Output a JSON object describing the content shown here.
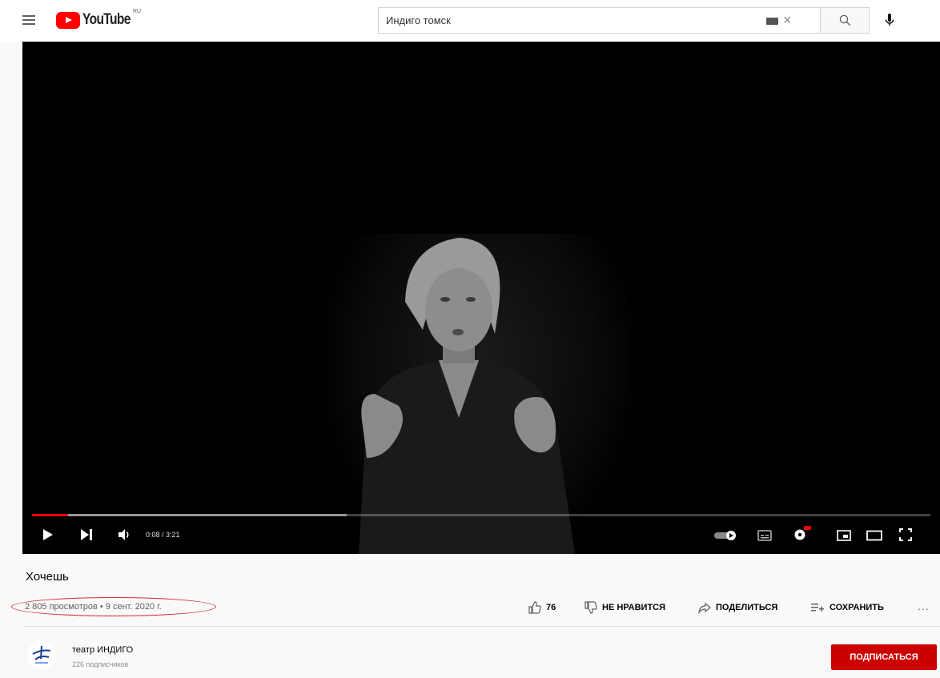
{
  "header": {
    "logo_text": "YouTube",
    "logo_country": "RU",
    "search_value": "Индиго томск"
  },
  "player": {
    "time": "0:08 / 3:21",
    "progress_played_pct": 4,
    "progress_buffered_pct": 35
  },
  "video": {
    "title": "Хочешь",
    "meta": "2 805 просмотров • 9 сент. 2020 г."
  },
  "actions": {
    "likes": "76",
    "dislike_label": "НЕ НРАВИТСЯ",
    "share_label": "ПОДЕЛИТЬСЯ",
    "save_label": "СОХРАНИТЬ",
    "more": "..."
  },
  "channel": {
    "name": "театр ИНДИГО",
    "subscribers": "226 подписчиков",
    "subscribe_label": "ПОДПИСАТЬСЯ"
  },
  "colors": {
    "brand": "#ff0000",
    "subscribe": "#cc0000",
    "annotation": "#d8262a"
  }
}
